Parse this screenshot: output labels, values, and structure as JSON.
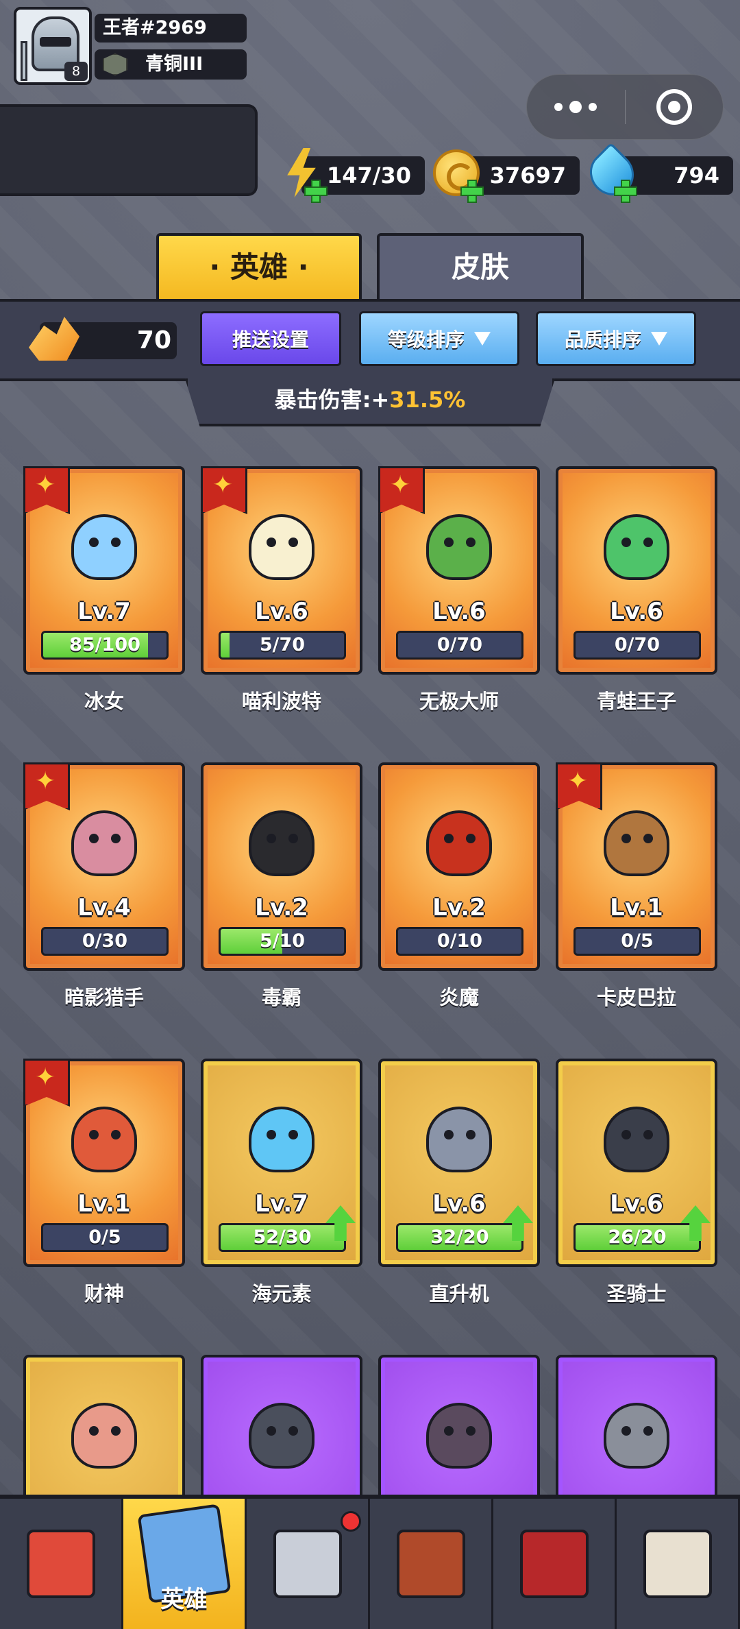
{
  "profile": {
    "name": "王者#2969",
    "rank": "青铜III",
    "rank_numeral": "III",
    "level": "8"
  },
  "resources": {
    "energy": "147/30",
    "gold": "37697",
    "gems": "794"
  },
  "tabs": {
    "hero": "· 英雄 ·",
    "skin": "皮肤"
  },
  "filters": {
    "crystals": "70",
    "push": "推送设置",
    "level_sort": "等级排序",
    "quality_sort": "品质排序"
  },
  "crit": {
    "label": "暴击伤害:+",
    "value": "31.5",
    "unit": "%"
  },
  "heroes": [
    {
      "name": "冰女",
      "level": "Lv.7",
      "progress": "85/100",
      "fill": 0.85,
      "rarity": "orange",
      "star": true,
      "upgrade": false,
      "color": "#8fd0ff"
    },
    {
      "name": "喵利波特",
      "level": "Lv.6",
      "progress": "5/70",
      "fill": 0.07,
      "rarity": "orange",
      "star": true,
      "upgrade": false,
      "color": "#f8f0d0"
    },
    {
      "name": "无极大师",
      "level": "Lv.6",
      "progress": "0/70",
      "fill": 0,
      "rarity": "orange",
      "star": true,
      "upgrade": false,
      "color": "#5bb04a"
    },
    {
      "name": "青蛙王子",
      "level": "Lv.6",
      "progress": "0/70",
      "fill": 0,
      "rarity": "orange",
      "star": false,
      "upgrade": false,
      "color": "#4ec46a"
    },
    {
      "name": "暗影猎手",
      "level": "Lv.4",
      "progress": "0/30",
      "fill": 0,
      "rarity": "orange",
      "star": true,
      "upgrade": false,
      "color": "#d98da0"
    },
    {
      "name": "毒霸",
      "level": "Lv.2",
      "progress": "5/10",
      "fill": 0.5,
      "rarity": "orange",
      "star": false,
      "upgrade": false,
      "color": "#2a2a2e"
    },
    {
      "name": "炎魔",
      "level": "Lv.2",
      "progress": "0/10",
      "fill": 0,
      "rarity": "orange",
      "star": false,
      "upgrade": false,
      "color": "#c8321e"
    },
    {
      "name": "卡皮巴拉",
      "level": "Lv.1",
      "progress": "0/5",
      "fill": 0,
      "rarity": "orange",
      "star": true,
      "upgrade": false,
      "color": "#b0763e"
    },
    {
      "name": "财神",
      "level": "Lv.1",
      "progress": "0/5",
      "fill": 0,
      "rarity": "orange",
      "star": true,
      "upgrade": false,
      "color": "#e05a3a"
    },
    {
      "name": "海元素",
      "level": "Lv.7",
      "progress": "52/30",
      "fill": 1,
      "rarity": "gold",
      "star": false,
      "upgrade": true,
      "color": "#5fc6f5"
    },
    {
      "name": "直升机",
      "level": "Lv.6",
      "progress": "32/20",
      "fill": 1,
      "rarity": "gold",
      "star": false,
      "upgrade": true,
      "color": "#8a94a8"
    },
    {
      "name": "圣骑士",
      "level": "Lv.6",
      "progress": "26/20",
      "fill": 1,
      "rarity": "gold",
      "star": false,
      "upgrade": true,
      "color": "#3a3e4a"
    },
    {
      "name": "",
      "level": "",
      "progress": "",
      "fill": 0,
      "rarity": "gold",
      "star": false,
      "upgrade": false,
      "color": "#e89a8a"
    },
    {
      "name": "",
      "level": "",
      "progress": "",
      "fill": 0,
      "rarity": "purple",
      "star": false,
      "upgrade": false,
      "color": "#4a4f5c"
    },
    {
      "name": "",
      "level": "",
      "progress": "",
      "fill": 0,
      "rarity": "purple",
      "star": false,
      "upgrade": false,
      "color": "#5a4a5e"
    },
    {
      "name": "",
      "level": "",
      "progress": "",
      "fill": 0,
      "rarity": "purple",
      "star": false,
      "upgrade": false,
      "color": "#8a8f9a"
    }
  ],
  "nav": [
    {
      "icon": "shop-icon",
      "label": "",
      "active": false,
      "badge": false
    },
    {
      "icon": "hero-cards-icon",
      "label": "英雄",
      "active": true,
      "badge": false
    },
    {
      "icon": "battle-swords-icon",
      "label": "",
      "active": false,
      "badge": true
    },
    {
      "icon": "trophy-cup-icon",
      "label": "",
      "active": false,
      "badge": false
    },
    {
      "icon": "guild-banner-icon",
      "label": "",
      "active": false,
      "badge": false
    },
    {
      "icon": "castle-icon",
      "label": "",
      "active": false,
      "badge": false
    }
  ]
}
